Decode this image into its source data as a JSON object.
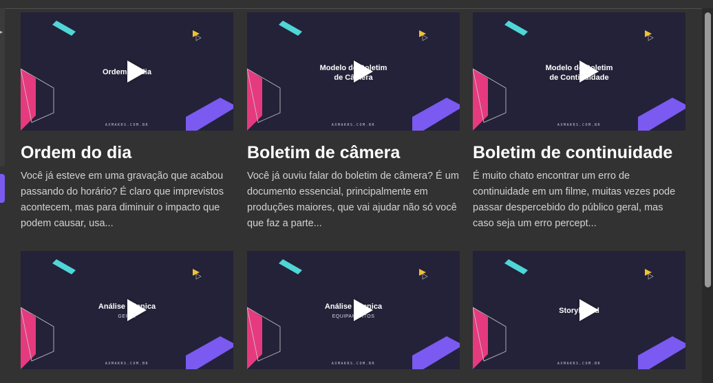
{
  "colors": {
    "background": "#323232",
    "thumb_bg": "#242238",
    "teal": "#4fd6d6",
    "pink": "#e63a7f",
    "purple": "#7a5af0",
    "yellow": "#f2c12e"
  },
  "cards": [
    {
      "thumb_title_line1": "Ordem do dia",
      "thumb_title_line2": "",
      "thumb_subtitle": "",
      "site": "AXMAKRS.COM.BR",
      "title": "Ordem do dia",
      "description": "Você já esteve em uma gravação que acabou passando do horário? É claro que imprevistos acontecem, mas para diminuir o impacto que podem causar, usa..."
    },
    {
      "thumb_title_line1": "Modelo de Boletim",
      "thumb_title_line2": "de Câmera",
      "thumb_subtitle": "",
      "site": "AXMAKRS.COM.BR",
      "title": "Boletim de câmera",
      "description": "Você já ouviu falar do boletim de câmera? É um documento essencial, principalmente em produções maiores, que vai ajudar não só você que faz a parte..."
    },
    {
      "thumb_title_line1": "Modelo de Boletim",
      "thumb_title_line2": "de Continuidade",
      "thumb_subtitle": "",
      "site": "AXMAKRS.COM.BR",
      "title": "Boletim de continuidade",
      "description": "É muito chato encontrar um erro de continuidade em um filme, muitas vezes pode passar despercebido do público geral, mas caso seja um erro percept..."
    },
    {
      "thumb_title_line1": "Análise Técnica",
      "thumb_title_line2": "",
      "thumb_subtitle": "GERAL",
      "site": "AXMAKRS.COM.BR",
      "title": "",
      "description": ""
    },
    {
      "thumb_title_line1": "Análise Técnica",
      "thumb_title_line2": "",
      "thumb_subtitle": "EQUIPAMENTOS",
      "site": "AXMAKRS.COM.BR",
      "title": "",
      "description": ""
    },
    {
      "thumb_title_line1": "Storyboard",
      "thumb_title_line2": "",
      "thumb_subtitle": "",
      "site": "AXMAKRS.COM.BR",
      "title": "",
      "description": ""
    }
  ]
}
